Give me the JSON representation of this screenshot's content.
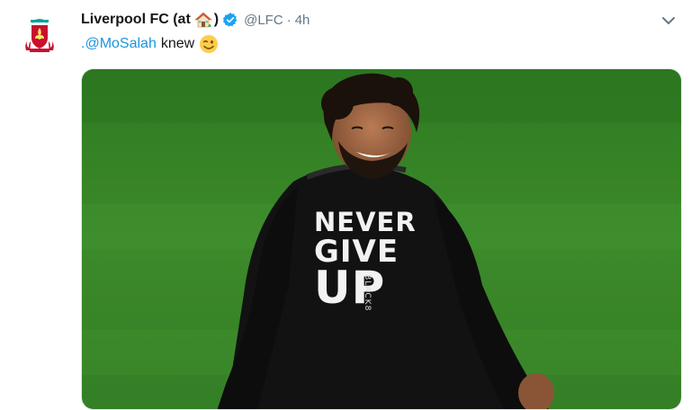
{
  "tweet": {
    "author_name": "Liverpool FC (at",
    "author_name_close": ")",
    "handle": "@LFC",
    "separator": "·",
    "time": "4h",
    "mention": ".@MoSalah",
    "text_after_mention": "knew",
    "emojis": [
      "house-emoji",
      "winking-face-emoji"
    ],
    "media": {
      "shirt_lines": [
        "NEVER",
        "GIVE",
        "UP"
      ],
      "shirt_brand": "BLACK8"
    }
  },
  "colors": {
    "link": "#1b95e0",
    "secondary_text": "#657786",
    "verified": "#1da1f2",
    "pitch": "#3c8a2a"
  }
}
